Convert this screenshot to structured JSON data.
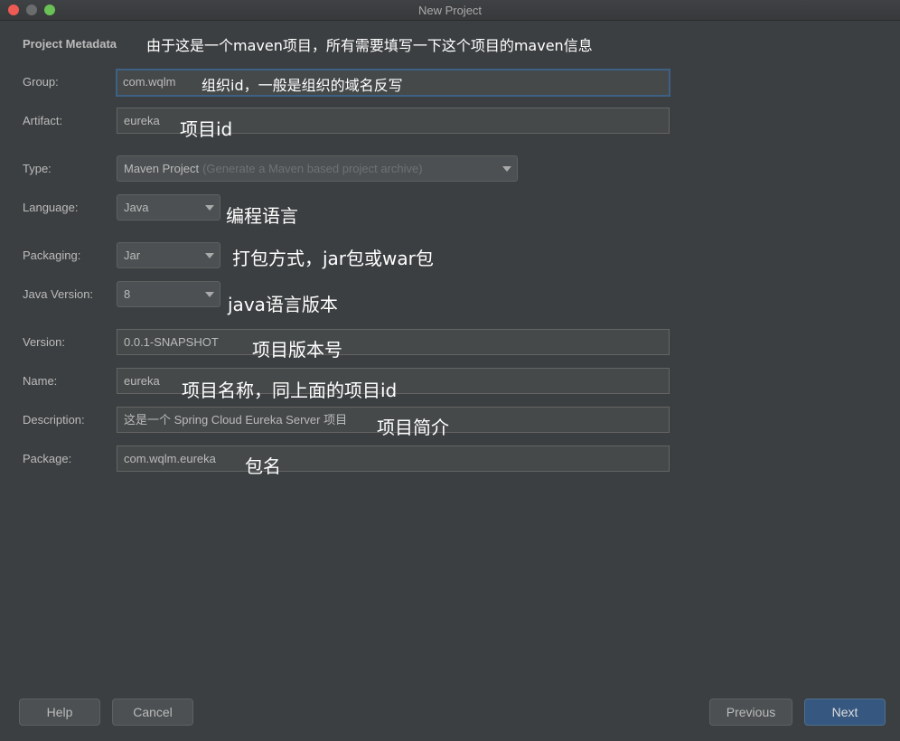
{
  "window": {
    "title": "New Project"
  },
  "section": {
    "title": "Project Metadata",
    "annotation": "由于这是一个maven项目，所有需要填写一下这个项目的maven信息"
  },
  "fields": {
    "group": {
      "label": "Group:",
      "value": "com.wqlm",
      "annotation": "组织id，一般是组织的域名反写"
    },
    "artifact": {
      "label": "Artifact:",
      "value": "eureka",
      "annotation": "项目id"
    },
    "type": {
      "label": "Type:",
      "value": "Maven Project",
      "hint": "(Generate a Maven based project archive)"
    },
    "language": {
      "label": "Language:",
      "value": "Java",
      "annotation": "编程语言"
    },
    "packaging": {
      "label": "Packaging:",
      "value": "Jar",
      "annotation": "打包方式，jar包或war包"
    },
    "java_version": {
      "label": "Java Version:",
      "value": "8",
      "annotation": "java语言版本"
    },
    "version": {
      "label": "Version:",
      "value": "0.0.1-SNAPSHOT",
      "annotation": "项目版本号"
    },
    "name": {
      "label": "Name:",
      "value": "eureka",
      "annotation": "项目名称，同上面的项目id"
    },
    "description": {
      "label": "Description:",
      "value": "这是一个 Spring Cloud Eureka Server 项目",
      "annotation": "项目简介"
    },
    "package": {
      "label": "Package:",
      "value": "com.wqlm.eureka",
      "annotation": "包名"
    }
  },
  "buttons": {
    "help": "Help",
    "cancel": "Cancel",
    "previous": "Previous",
    "next": "Next"
  },
  "colors": {
    "background": "#3c3f41",
    "field_bg": "#45494a",
    "focus_border": "#3d6185",
    "primary_button": "#365880"
  }
}
